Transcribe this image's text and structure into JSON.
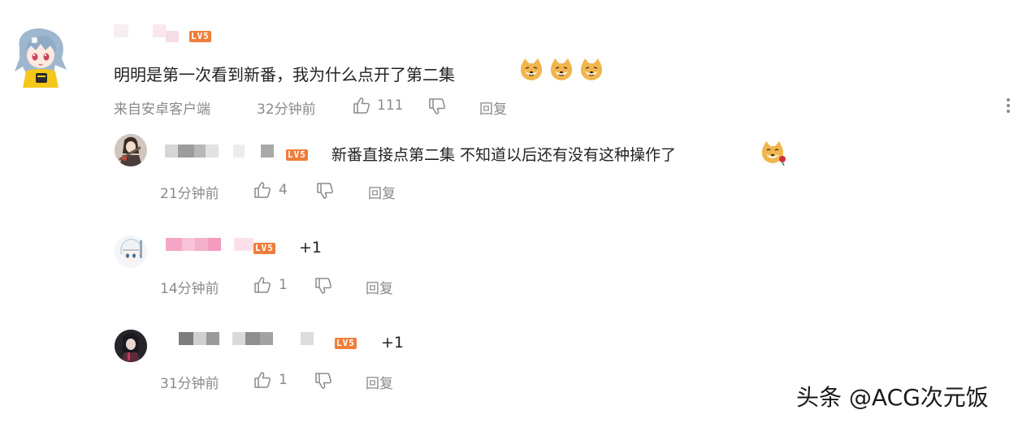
{
  "main_comment": {
    "level_badge": "LV5",
    "text": "明明是第一次看到新番，我为什么点开了第二集",
    "source": "来自安卓客户端",
    "time": "32分钟前",
    "likes": "111",
    "reply_label": "回复",
    "emojis": [
      "shiba-dog-emoji",
      "shiba-dog-emoji",
      "shiba-dog-emoji"
    ]
  },
  "replies": [
    {
      "level_badge": "LV5",
      "text": "新番直接点第二集 不知道以后还有没有这种操作了",
      "time": "21分钟前",
      "likes": "4",
      "reply_label": "回复",
      "emojis": [
        "shiba-rose-emoji"
      ]
    },
    {
      "level_badge": "LV5",
      "text": "+1",
      "time": "14分钟前",
      "likes": "1",
      "reply_label": "回复"
    },
    {
      "level_badge": "LV5",
      "text": "+1",
      "time": "31分钟前",
      "likes": "1",
      "reply_label": "回复"
    }
  ],
  "icons": {
    "like": "thumbs-up-icon",
    "dislike": "thumbs-down-icon",
    "more": "more-vertical-icon"
  },
  "colors": {
    "level_badge": "#ee7e3a",
    "meta_text": "#8a8a8a",
    "body_text": "#222222"
  },
  "watermark": "头条 @ACG次元饭"
}
